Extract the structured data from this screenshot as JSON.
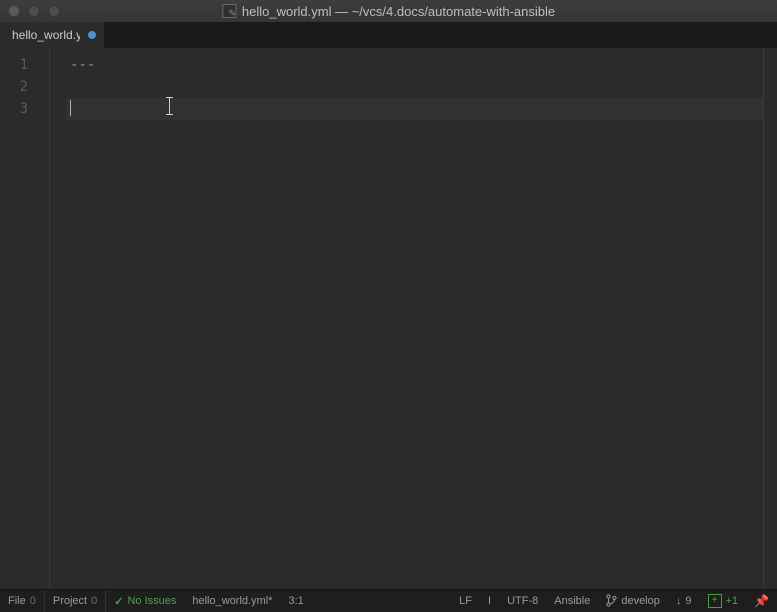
{
  "window": {
    "title": "hello_world.yml — ~/vcs/4.docs/automate-with-ansible"
  },
  "tabs": [
    {
      "label": "hello_world.yml",
      "dirty": true
    }
  ],
  "editor": {
    "lines": {
      "1": "---",
      "2": "",
      "3": ""
    },
    "cursor_line": 3
  },
  "status": {
    "file_label": "File",
    "file_count": "0",
    "project_label": "Project",
    "project_count": "0",
    "issues_check": "✓",
    "issues_text": "No Issues",
    "filename": "hello_world.yml*",
    "caret": "3:1",
    "line_ending": "LF",
    "indent_indicator": "I",
    "encoding": "UTF-8",
    "filetype": "Ansible",
    "branch": "develop",
    "down_count": "9",
    "plus_label": "+",
    "plus_count": "+1"
  }
}
